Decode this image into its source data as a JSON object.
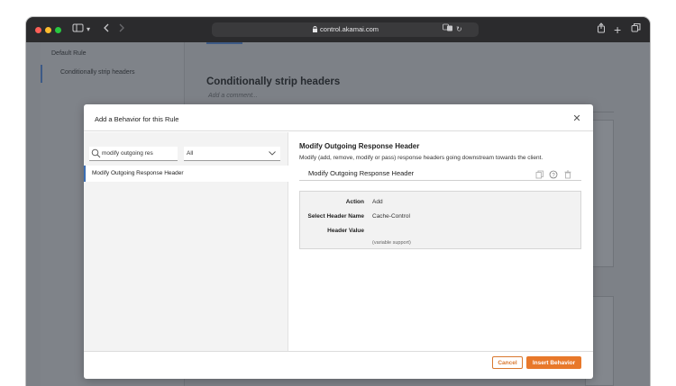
{
  "browser": {
    "url": "control.akamai.com"
  },
  "page": {
    "sidebar": {
      "items": [
        {
          "label": "Default Rule"
        },
        {
          "label": "Conditionally strip headers"
        }
      ]
    },
    "title": "Conditionally strip headers",
    "comment_placeholder": "Add a comment..."
  },
  "modal": {
    "title": "Add a Behavior for this Rule",
    "search": {
      "value": "modify outgoing res"
    },
    "filter": {
      "selected": "All"
    },
    "results": [
      {
        "label": "Modify Outgoing Response Header"
      }
    ],
    "detail": {
      "title": "Modify Outgoing Response Header",
      "description": "Modify (add, remove, modify or pass) response headers going downstream towards the client.",
      "subheading": "Modify Outgoing Response Header",
      "fields": [
        {
          "label": "Action",
          "value": "Add"
        },
        {
          "label": "Select Header Name",
          "value": "Cache-Control"
        },
        {
          "label": "Header Value",
          "value": ""
        }
      ],
      "variable_hint": "(variable support)"
    },
    "buttons": {
      "cancel": "Cancel",
      "insert": "Insert Behavior"
    },
    "colors": {
      "accent": "#e8782a",
      "selected_border": "#3b6eb4"
    }
  }
}
